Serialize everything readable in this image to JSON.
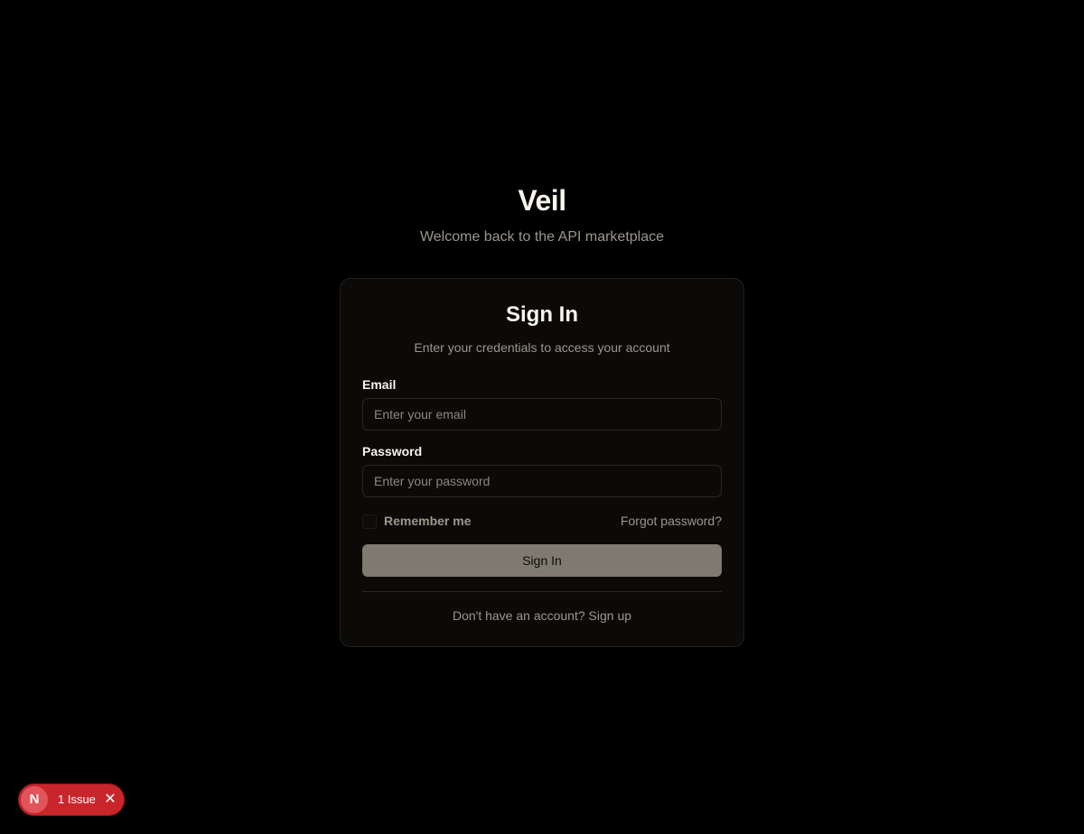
{
  "brand": {
    "name": "Veil",
    "tagline": "Welcome back to the API marketplace"
  },
  "card": {
    "title": "Sign In",
    "description": "Enter your credentials to access your account",
    "email": {
      "label": "Email",
      "placeholder": "Enter your email",
      "value": ""
    },
    "password": {
      "label": "Password",
      "placeholder": "Enter your password",
      "value": ""
    },
    "remember_label": "Remember me",
    "remember_checked": false,
    "forgot_label": "Forgot password?",
    "submit_label": "Sign In",
    "signup_prompt": "Don't have an account?",
    "signup_link": "Sign up"
  },
  "dev_overlay": {
    "logo_letter": "N",
    "issues_label": "1 Issue",
    "close_icon": "close-icon",
    "color": "#c8262b"
  }
}
